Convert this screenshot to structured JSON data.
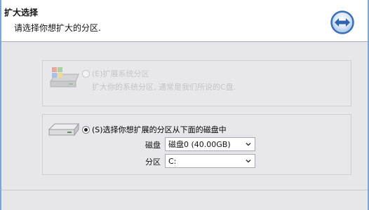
{
  "header": {
    "title": "扩大选择",
    "subtitle": "请选择你想扩大的分区.",
    "nav_icon": "double-arrow-icon"
  },
  "options": {
    "system": {
      "label": "(E)扩展系统分区",
      "description": "扩大你的系统分区, 通常是我们所说的C盘.",
      "enabled": false,
      "selected": false
    },
    "choose": {
      "label": "(S)选择你想扩展的分区从下面的磁盘中",
      "enabled": true,
      "selected": true,
      "disk_label": "磁盘",
      "disk_value": "磁盘0 (40.00GB)",
      "partition_label": "分区",
      "partition_value": "C:"
    }
  },
  "colors": {
    "background": "#e7e6ea",
    "header_bg": "#ffffff",
    "icon_blue": "#3b6fb6"
  }
}
